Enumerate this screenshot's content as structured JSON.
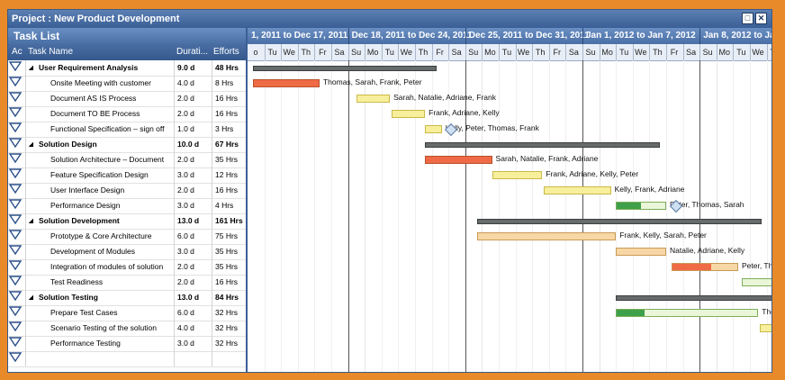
{
  "window": {
    "title": "Project : New Product Development",
    "btn_restore": "□",
    "btn_close": "✕"
  },
  "tasklist": {
    "header": "Task List",
    "columns": [
      "Ac",
      "Task Name",
      "Durati...",
      "Efforts"
    ],
    "rows": [
      {
        "name": "User Requirement Analysis",
        "duration": "9.0 d",
        "efforts": "48 Hrs",
        "summary": true
      },
      {
        "name": "Onsite Meeting with customer",
        "duration": "4.0 d",
        "efforts": "8 Hrs",
        "summary": false
      },
      {
        "name": "Document AS IS Process",
        "duration": "2.0 d",
        "efforts": "16 Hrs",
        "summary": false
      },
      {
        "name": "Document TO BE Process",
        "duration": "2.0 d",
        "efforts": "16 Hrs",
        "summary": false
      },
      {
        "name": "Functional Specification – sign off",
        "duration": "1.0 d",
        "efforts": "3 Hrs",
        "summary": false
      },
      {
        "name": "Solution Design",
        "duration": "10.0 d",
        "efforts": "67 Hrs",
        "summary": true
      },
      {
        "name": "Solution Architecture – Document",
        "duration": "2.0 d",
        "efforts": "35 Hrs",
        "summary": false
      },
      {
        "name": "Feature Specification Design",
        "duration": "3.0 d",
        "efforts": "12 Hrs",
        "summary": false
      },
      {
        "name": "User Interface Design",
        "duration": "2.0 d",
        "efforts": "16 Hrs",
        "summary": false
      },
      {
        "name": "Performance Design",
        "duration": "3.0 d",
        "efforts": "4 Hrs",
        "summary": false
      },
      {
        "name": "Solution Development",
        "duration": "13.0 d",
        "efforts": "161 Hrs",
        "summary": true
      },
      {
        "name": "Prototype & Core Architecture",
        "duration": "6.0 d",
        "efforts": "75 Hrs",
        "summary": false
      },
      {
        "name": "Development of Modules",
        "duration": "3.0 d",
        "efforts": "35 Hrs",
        "summary": false
      },
      {
        "name": "Integration of modules of solution",
        "duration": "2.0 d",
        "efforts": "35 Hrs",
        "summary": false
      },
      {
        "name": "Test Readiness",
        "duration": "2.0 d",
        "efforts": "16 Hrs",
        "summary": false
      },
      {
        "name": "Solution Testing",
        "duration": "13.0 d",
        "efforts": "84 Hrs",
        "summary": true
      },
      {
        "name": "Prepare Test Cases",
        "duration": "6.0 d",
        "efforts": "32 Hrs",
        "summary": false
      },
      {
        "name": "Scenario Testing of the solution",
        "duration": "4.0 d",
        "efforts": "32 Hrs",
        "summary": false
      },
      {
        "name": "Performance Testing",
        "duration": "3.0 d",
        "efforts": "32 Hrs",
        "summary": false
      }
    ]
  },
  "timeline": {
    "weeks": [
      "1, 2011 to Dec 17, 2011",
      "Dec 18, 2011 to Dec 24, 2011",
      "Dec 25, 2011 to Dec 31, 2011",
      "Jan 1, 2012 to Jan 7, 2012",
      "Jan 8, 2012 to Ja"
    ],
    "days": [
      "o",
      "Tu",
      "We",
      "Th",
      "Fr",
      "Sa",
      "Su",
      "Mo",
      "Tu",
      "We",
      "Th",
      "Fr",
      "Sa",
      "Su",
      "Mo",
      "Tu",
      "We",
      "Th",
      "Fr",
      "Sa",
      "Su",
      "Mo",
      "Tu",
      "We",
      "Th",
      "Fr",
      "Sa",
      "Su",
      "Mo",
      "Tu",
      "We",
      "Th",
      "Fr"
    ]
  },
  "bars": [
    {
      "row": 0,
      "type": "summary",
      "start": 0.3,
      "len": 11
    },
    {
      "row": 1,
      "type": "red",
      "start": 0.3,
      "len": 4,
      "label": "Thomas, Sarah, Frank, Peter"
    },
    {
      "row": 2,
      "type": "yellow",
      "start": 6.5,
      "len": 2,
      "label": "Sarah, Natalie, Adriane, Frank"
    },
    {
      "row": 3,
      "type": "yellow",
      "start": 8.6,
      "len": 2,
      "label": "Frank, Adriane, Kelly"
    },
    {
      "row": 4,
      "type": "yellow",
      "start": 10.6,
      "len": 1,
      "label": "Kelly, Peter, Thomas, Frank"
    },
    {
      "row": 5,
      "type": "summary",
      "start": 10.6,
      "len": 14
    },
    {
      "row": 6,
      "type": "red",
      "start": 10.6,
      "len": 4,
      "label": "Sarah, Natalie, Frank, Adriane"
    },
    {
      "row": 7,
      "type": "yellow",
      "start": 14.6,
      "len": 3,
      "label": "Frank, Adriane, Kelly, Peter"
    },
    {
      "row": 8,
      "type": "yellow",
      "start": 17.7,
      "len": 4,
      "label": "Kelly, Frank, Adriane"
    },
    {
      "row": 9,
      "type": "green",
      "start": 22,
      "len": 3,
      "progress": 0.5,
      "label": "Peter, Thomas, Sarah"
    },
    {
      "row": 10,
      "type": "summary",
      "start": 13.7,
      "len": 17
    },
    {
      "row": 11,
      "type": "orange",
      "start": 13.7,
      "len": 8.3,
      "label": "Frank, Kelly, Sarah, Peter"
    },
    {
      "row": 12,
      "type": "orange",
      "start": 22,
      "len": 3,
      "label": "Natalie, Adriane, Kelly"
    },
    {
      "row": 13,
      "type": "orange",
      "start": 25.3,
      "len": 4,
      "progress": 0.6,
      "progressColor": "red",
      "label": "Peter, Th"
    },
    {
      "row": 14,
      "type": "green",
      "start": 29.5,
      "len": 2
    },
    {
      "row": 15,
      "type": "summary",
      "start": 22,
      "len": 10
    },
    {
      "row": 16,
      "type": "green",
      "start": 22,
      "len": 8.5,
      "progress": 0.2,
      "label": "Tho"
    },
    {
      "row": 17,
      "type": "yellow",
      "start": 30.6,
      "len": 2
    }
  ]
}
